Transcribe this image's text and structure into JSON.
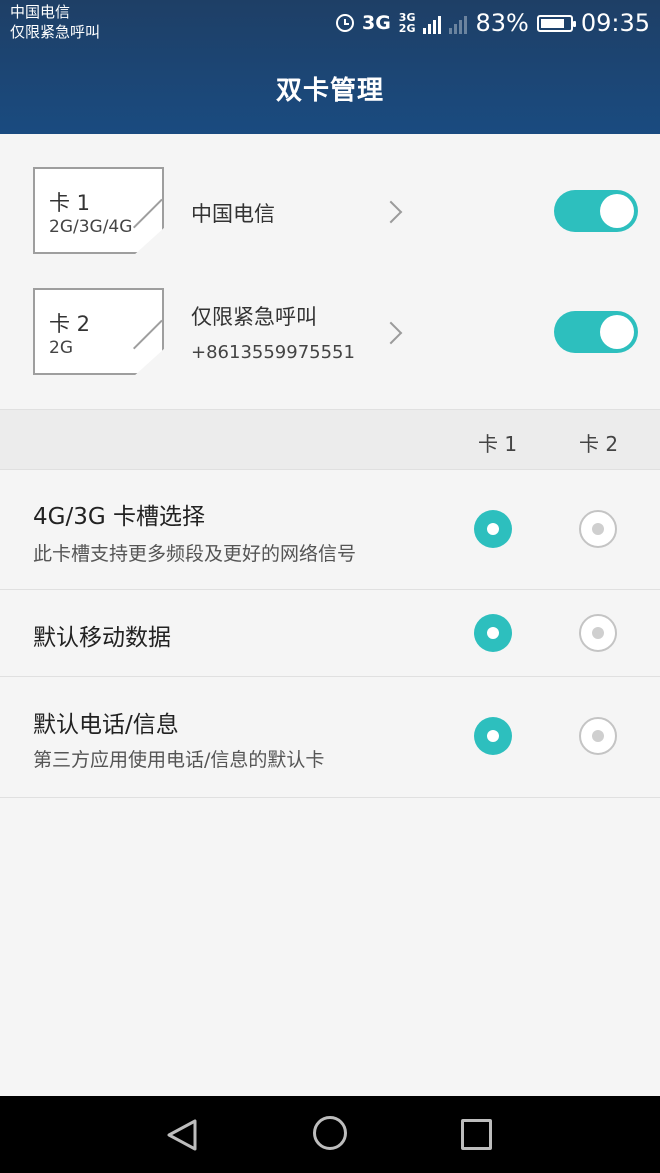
{
  "status_bar": {
    "carrier_line1": "中国电信",
    "carrier_line2": "仅限紧急呼叫",
    "network_type": "3G",
    "network_small_top": "3G",
    "network_small_bottom": "2G",
    "battery_percent": "83%",
    "battery_level": 0.83,
    "time": "09:35"
  },
  "header": {
    "title": "双卡管理"
  },
  "sims": [
    {
      "name": "卡 1",
      "type": "2G/3G/4G",
      "carrier": "中国电信",
      "number": "",
      "enabled": true
    },
    {
      "name": "卡 2",
      "type": "2G",
      "carrier": "仅限紧急呼叫",
      "number": "+8613559975551",
      "enabled": true
    }
  ],
  "columns": {
    "card1": "卡 1",
    "card2": "卡 2"
  },
  "settings": [
    {
      "title": "4G/3G 卡槽选择",
      "subtitle": "此卡槽支持更多频段及更好的网络信号",
      "selected": "card1"
    },
    {
      "title": "默认移动数据",
      "subtitle": "",
      "selected": "card1"
    },
    {
      "title": "默认电话/信息",
      "subtitle": "第三方应用使用电话/信息的默认卡",
      "selected": "card1"
    }
  ],
  "icons": {
    "alarm": "alarm-icon",
    "signal": "signal-icon",
    "battery": "battery-icon",
    "chevron": "chevron-right-icon",
    "back": "back-icon",
    "home": "home-icon",
    "recent": "recent-apps-icon"
  },
  "colors": {
    "header": "#1e3f66",
    "accent": "#2dbfbe",
    "navbar": "#000000"
  }
}
